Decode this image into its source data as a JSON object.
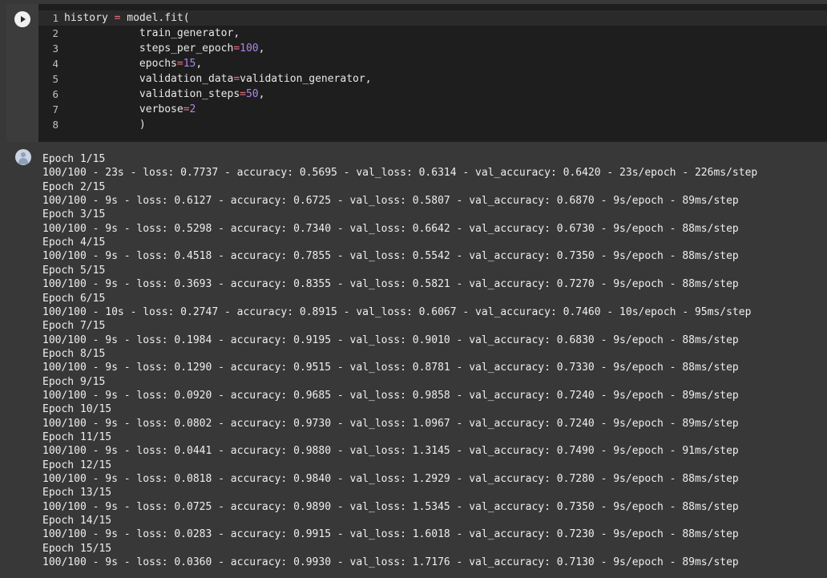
{
  "code_cell": {
    "lines": [
      {
        "num": "1",
        "tokens": [
          {
            "t": "history ",
            "c": ""
          },
          {
            "t": "=",
            "c": "op"
          },
          {
            "t": " model.fit(",
            "c": ""
          }
        ]
      },
      {
        "num": "2",
        "tokens": [
          {
            "t": "            train_generator,",
            "c": ""
          }
        ]
      },
      {
        "num": "3",
        "tokens": [
          {
            "t": "            steps_per_epoch",
            "c": ""
          },
          {
            "t": "=",
            "c": "op"
          },
          {
            "t": "100",
            "c": "num"
          },
          {
            "t": ",",
            "c": ""
          }
        ]
      },
      {
        "num": "4",
        "tokens": [
          {
            "t": "            epochs",
            "c": ""
          },
          {
            "t": "=",
            "c": "op"
          },
          {
            "t": "15",
            "c": "num"
          },
          {
            "t": ",",
            "c": ""
          }
        ]
      },
      {
        "num": "5",
        "tokens": [
          {
            "t": "            validation_data",
            "c": ""
          },
          {
            "t": "=",
            "c": "op"
          },
          {
            "t": "validation_generator,",
            "c": ""
          }
        ]
      },
      {
        "num": "6",
        "tokens": [
          {
            "t": "            validation_steps",
            "c": ""
          },
          {
            "t": "=",
            "c": "op"
          },
          {
            "t": "50",
            "c": "num"
          },
          {
            "t": ",",
            "c": ""
          }
        ]
      },
      {
        "num": "7",
        "tokens": [
          {
            "t": "            verbose",
            "c": ""
          },
          {
            "t": "=",
            "c": "op"
          },
          {
            "t": "2",
            "c": "num"
          }
        ]
      },
      {
        "num": "8",
        "tokens": [
          {
            "t": "            )",
            "c": ""
          }
        ]
      }
    ]
  },
  "output": {
    "lines": [
      "Epoch 1/15",
      "100/100 - 23s - loss: 0.7737 - accuracy: 0.5695 - val_loss: 0.6314 - val_accuracy: 0.6420 - 23s/epoch - 226ms/step",
      "Epoch 2/15",
      "100/100 - 9s - loss: 0.6127 - accuracy: 0.6725 - val_loss: 0.5807 - val_accuracy: 0.6870 - 9s/epoch - 89ms/step",
      "Epoch 3/15",
      "100/100 - 9s - loss: 0.5298 - accuracy: 0.7340 - val_loss: 0.6642 - val_accuracy: 0.6730 - 9s/epoch - 88ms/step",
      "Epoch 4/15",
      "100/100 - 9s - loss: 0.4518 - accuracy: 0.7855 - val_loss: 0.5542 - val_accuracy: 0.7350 - 9s/epoch - 88ms/step",
      "Epoch 5/15",
      "100/100 - 9s - loss: 0.3693 - accuracy: 0.8355 - val_loss: 0.5821 - val_accuracy: 0.7270 - 9s/epoch - 88ms/step",
      "Epoch 6/15",
      "100/100 - 10s - loss: 0.2747 - accuracy: 0.8915 - val_loss: 0.6067 - val_accuracy: 0.7460 - 10s/epoch - 95ms/step",
      "Epoch 7/15",
      "100/100 - 9s - loss: 0.1984 - accuracy: 0.9195 - val_loss: 0.9010 - val_accuracy: 0.6830 - 9s/epoch - 88ms/step",
      "Epoch 8/15",
      "100/100 - 9s - loss: 0.1290 - accuracy: 0.9515 - val_loss: 0.8781 - val_accuracy: 0.7330 - 9s/epoch - 88ms/step",
      "Epoch 9/15",
      "100/100 - 9s - loss: 0.0920 - accuracy: 0.9685 - val_loss: 0.9858 - val_accuracy: 0.7240 - 9s/epoch - 89ms/step",
      "Epoch 10/15",
      "100/100 - 9s - loss: 0.0802 - accuracy: 0.9730 - val_loss: 1.0967 - val_accuracy: 0.7240 - 9s/epoch - 89ms/step",
      "Epoch 11/15",
      "100/100 - 9s - loss: 0.0441 - accuracy: 0.9880 - val_loss: 1.3145 - val_accuracy: 0.7490 - 9s/epoch - 91ms/step",
      "Epoch 12/15",
      "100/100 - 9s - loss: 0.0818 - accuracy: 0.9840 - val_loss: 1.2929 - val_accuracy: 0.7280 - 9s/epoch - 88ms/step",
      "Epoch 13/15",
      "100/100 - 9s - loss: 0.0725 - accuracy: 0.9890 - val_loss: 1.5345 - val_accuracy: 0.7350 - 9s/epoch - 88ms/step",
      "Epoch 14/15",
      "100/100 - 9s - loss: 0.0283 - accuracy: 0.9915 - val_loss: 1.6018 - val_accuracy: 0.7230 - 9s/epoch - 88ms/step",
      "Epoch 15/15",
      "100/100 - 9s - loss: 0.0360 - accuracy: 0.9930 - val_loss: 1.7176 - val_accuracy: 0.7130 - 9s/epoch - 89ms/step"
    ]
  }
}
